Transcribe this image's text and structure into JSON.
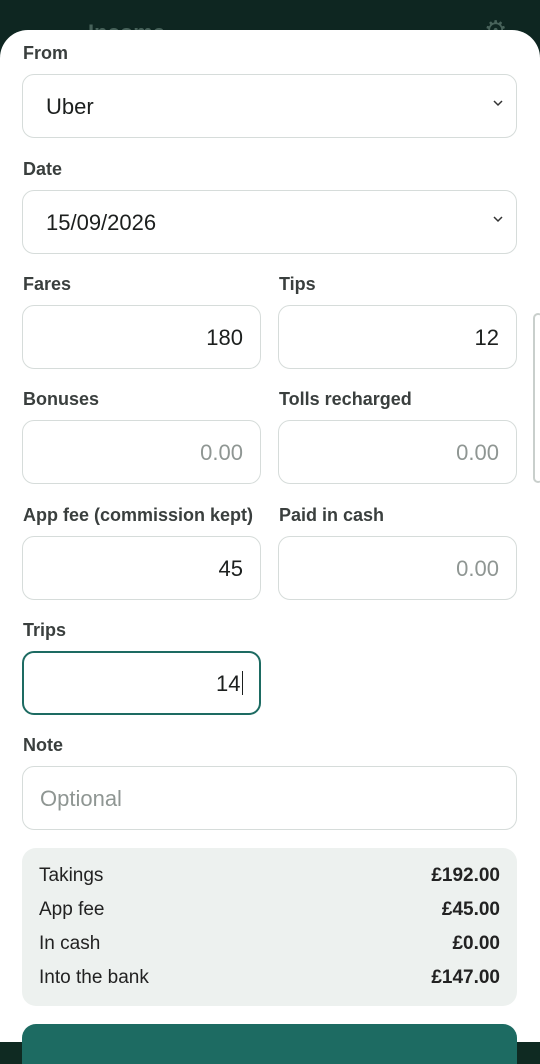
{
  "appbar": {
    "title": "Income"
  },
  "form": {
    "from": {
      "label": "From",
      "value": "Uber"
    },
    "date": {
      "label": "Date",
      "value": "15/09/2026"
    },
    "fares": {
      "label": "Fares",
      "value": "180"
    },
    "tips": {
      "label": "Tips",
      "value": "12"
    },
    "bonuses": {
      "label": "Bonuses",
      "placeholder": "0.00"
    },
    "tolls": {
      "label": "Tolls recharged",
      "placeholder": "0.00"
    },
    "app_fee": {
      "label": "App fee (commission kept)",
      "value": "45"
    },
    "cash": {
      "label": "Paid in cash",
      "placeholder": "0.00"
    },
    "trips": {
      "label": "Trips",
      "value": "14"
    },
    "note": {
      "label": "Note",
      "placeholder": "Optional"
    }
  },
  "summary": {
    "rows": [
      {
        "label": "Takings",
        "value": "£192.00"
      },
      {
        "label": "App fee",
        "value": "£45.00"
      },
      {
        "label": "In cash",
        "value": "£0.00"
      },
      {
        "label": "Into the bank",
        "value": "£147.00"
      }
    ]
  },
  "colors": {
    "accent": "#1d6b62",
    "appbar": "#0e2621",
    "summary_bg": "#edf1ef"
  }
}
